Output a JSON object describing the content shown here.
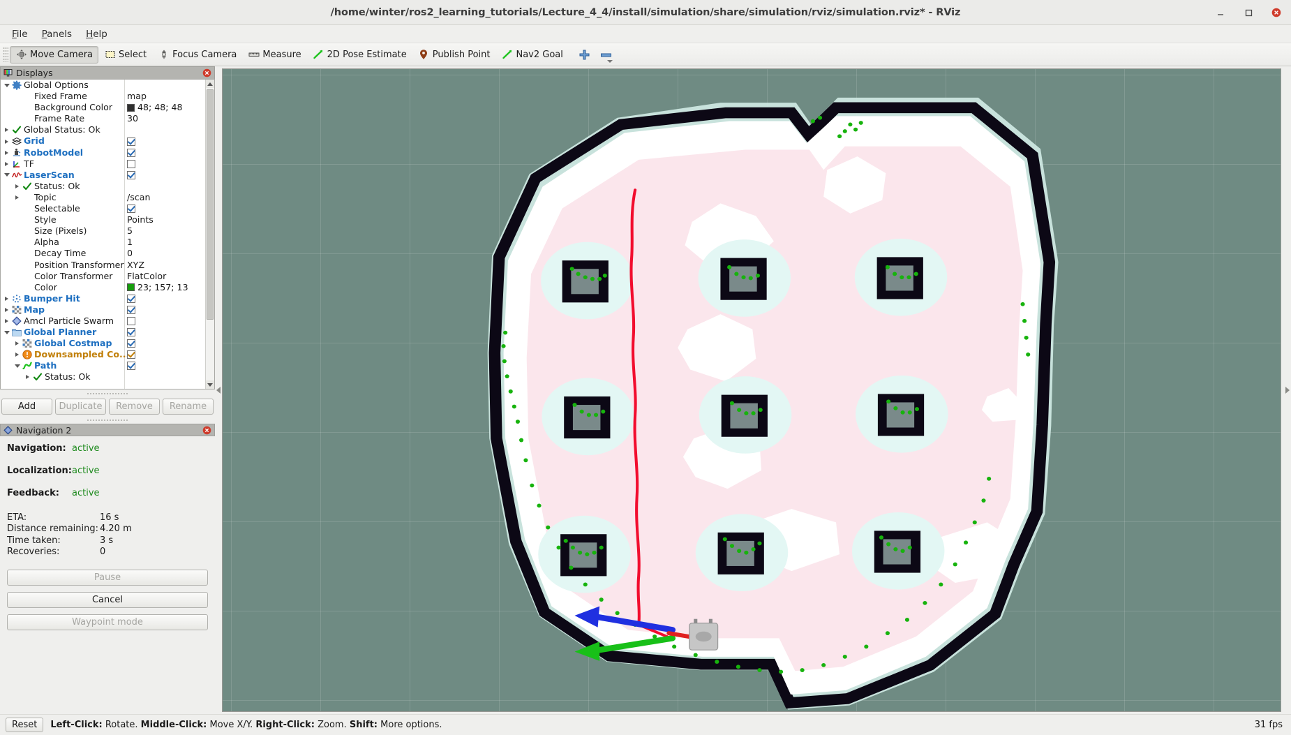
{
  "window": {
    "title": "/home/winter/ros2_learning_tutorials/Lecture_4_4/install/simulation/share/simulation/rviz/simulation.rviz* - RViz",
    "minimize_icon": "minimize-icon",
    "maximize_icon": "maximize-icon",
    "close_icon": "close-icon"
  },
  "menubar": {
    "items": [
      {
        "label": "File",
        "mnemonic": "F"
      },
      {
        "label": "Panels",
        "mnemonic": "P"
      },
      {
        "label": "Help",
        "mnemonic": "H"
      }
    ]
  },
  "toolbar": {
    "buttons": [
      {
        "label": "Move Camera",
        "icon": "move-camera-icon",
        "active": true
      },
      {
        "label": "Select",
        "icon": "select-icon",
        "active": false
      },
      {
        "label": "Focus Camera",
        "icon": "focus-camera-icon",
        "active": false
      },
      {
        "label": "Measure",
        "icon": "measure-icon",
        "active": false
      },
      {
        "label": "2D Pose Estimate",
        "icon": "pose-estimate-icon",
        "active": false
      },
      {
        "label": "Publish Point",
        "icon": "publish-point-icon",
        "active": false
      },
      {
        "label": "Nav2 Goal",
        "icon": "nav2-goal-icon",
        "active": false
      }
    ],
    "add_tool_icon": "plus-icon",
    "remove_tool_icon": "minus-icon",
    "overflow_icon": "chevron-down-icon"
  },
  "displays_panel": {
    "title": "Displays",
    "icon": "displays-icon",
    "close_icon": "close-icon",
    "rows": [
      {
        "indent": 0,
        "arrow": "open",
        "icon": "gear-icon",
        "label": "Global Options",
        "style": "normal",
        "value_type": "none"
      },
      {
        "indent": 1,
        "arrow": "none",
        "icon": "none",
        "label": "Fixed Frame",
        "style": "normal",
        "value_type": "text",
        "value": "map"
      },
      {
        "indent": 1,
        "arrow": "none",
        "icon": "none",
        "label": "Background Color",
        "style": "normal",
        "value_type": "color",
        "value": "48; 48; 48",
        "color": "#303030"
      },
      {
        "indent": 1,
        "arrow": "none",
        "icon": "none",
        "label": "Frame Rate",
        "style": "normal",
        "value_type": "text",
        "value": "30"
      },
      {
        "indent": 0,
        "arrow": "closed",
        "icon": "check-icon",
        "label": "Global Status: Ok",
        "style": "normal",
        "value_type": "none"
      },
      {
        "indent": 0,
        "arrow": "closed",
        "icon": "grid-icon",
        "label": "Grid",
        "style": "bluebold",
        "value_type": "check",
        "checked": true
      },
      {
        "indent": 0,
        "arrow": "closed",
        "icon": "robotmodel-icon",
        "label": "RobotModel",
        "style": "bluebold",
        "value_type": "check",
        "checked": true
      },
      {
        "indent": 0,
        "arrow": "closed",
        "icon": "tf-icon",
        "label": "TF",
        "style": "normal",
        "value_type": "check",
        "checked": false
      },
      {
        "indent": 0,
        "arrow": "open",
        "icon": "laserscan-icon",
        "label": "LaserScan",
        "style": "bluebold",
        "value_type": "check",
        "checked": true
      },
      {
        "indent": 1,
        "arrow": "closed",
        "icon": "check-icon",
        "label": "Status: Ok",
        "style": "normal",
        "value_type": "none"
      },
      {
        "indent": 1,
        "arrow": "closed",
        "icon": "none",
        "label": "Topic",
        "style": "normal",
        "value_type": "text",
        "value": "/scan"
      },
      {
        "indent": 1,
        "arrow": "none",
        "icon": "none",
        "label": "Selectable",
        "style": "normal",
        "value_type": "check",
        "checked": true
      },
      {
        "indent": 1,
        "arrow": "none",
        "icon": "none",
        "label": "Style",
        "style": "normal",
        "value_type": "text",
        "value": "Points"
      },
      {
        "indent": 1,
        "arrow": "none",
        "icon": "none",
        "label": "Size (Pixels)",
        "style": "normal",
        "value_type": "text",
        "value": "5"
      },
      {
        "indent": 1,
        "arrow": "none",
        "icon": "none",
        "label": "Alpha",
        "style": "normal",
        "value_type": "text",
        "value": "1"
      },
      {
        "indent": 1,
        "arrow": "none",
        "icon": "none",
        "label": "Decay Time",
        "style": "normal",
        "value_type": "text",
        "value": "0"
      },
      {
        "indent": 1,
        "arrow": "none",
        "icon": "none",
        "label": "Position Transformer",
        "style": "normal",
        "value_type": "text",
        "value": "XYZ"
      },
      {
        "indent": 1,
        "arrow": "none",
        "icon": "none",
        "label": "Color Transformer",
        "style": "normal",
        "value_type": "text",
        "value": "FlatColor"
      },
      {
        "indent": 1,
        "arrow": "none",
        "icon": "none",
        "label": "Color",
        "style": "normal",
        "value_type": "color",
        "value": "23; 157; 13",
        "color": "#179d0d"
      },
      {
        "indent": 0,
        "arrow": "closed",
        "icon": "bumperhit-icon",
        "label": "Bumper Hit",
        "style": "bluebold",
        "value_type": "check",
        "checked": true
      },
      {
        "indent": 0,
        "arrow": "closed",
        "icon": "map-icon",
        "label": "Map",
        "style": "bluebold",
        "value_type": "check",
        "checked": true
      },
      {
        "indent": 0,
        "arrow": "closed",
        "icon": "particle-icon",
        "label": "Amcl Particle Swarm",
        "style": "normal",
        "value_type": "check",
        "checked": false
      },
      {
        "indent": 0,
        "arrow": "open",
        "icon": "folder-icon",
        "label": "Global Planner",
        "style": "bluebold",
        "value_type": "check",
        "checked": true
      },
      {
        "indent": 1,
        "arrow": "closed",
        "icon": "map-icon",
        "label": "Global Costmap",
        "style": "bluebold",
        "value_type": "check",
        "checked": true
      },
      {
        "indent": 1,
        "arrow": "closed",
        "icon": "warning-icon",
        "label": "Downsampled Co...",
        "style": "orangebold",
        "value_type": "check",
        "checked": true,
        "check_color": "orange"
      },
      {
        "indent": 1,
        "arrow": "open",
        "icon": "path-icon",
        "label": "Path",
        "style": "bluebold",
        "value_type": "check",
        "checked": true
      },
      {
        "indent": 2,
        "arrow": "closed",
        "icon": "check-icon",
        "label": "Status: Ok",
        "style": "normal",
        "value_type": "none"
      }
    ],
    "buttons": [
      {
        "label": "Add",
        "disabled": false
      },
      {
        "label": "Duplicate",
        "disabled": true
      },
      {
        "label": "Remove",
        "disabled": true
      },
      {
        "label": "Rename",
        "disabled": true
      }
    ]
  },
  "navigation_panel": {
    "title": "Navigation 2",
    "icon": "nav2-icon",
    "close_icon": "close-icon",
    "statuses": [
      {
        "key": "Navigation:",
        "value": "active"
      },
      {
        "key": "Localization:",
        "value": "active"
      },
      {
        "key": "Feedback:",
        "value": "active"
      }
    ],
    "metrics": [
      {
        "key": "ETA:",
        "value": "16 s"
      },
      {
        "key": "Distance remaining:",
        "value": "4.20 m"
      },
      {
        "key": "Time taken:",
        "value": "3 s"
      },
      {
        "key": "Recoveries:",
        "value": "0"
      }
    ],
    "buttons": [
      {
        "label": "Pause",
        "disabled": true
      },
      {
        "label": "Cancel",
        "disabled": false
      },
      {
        "label": "Waypoint mode",
        "disabled": true
      }
    ],
    "status_color": "#1f8b1f"
  },
  "statusbar": {
    "reset_label": "Reset",
    "hint_parts": [
      {
        "text": "Left-Click:",
        "bold": true
      },
      {
        "text": " Rotate. ",
        "bold": false
      },
      {
        "text": "Middle-Click:",
        "bold": true
      },
      {
        "text": " Move X/Y. ",
        "bold": false
      },
      {
        "text": "Right-Click:",
        "bold": true
      },
      {
        "text": " Zoom. ",
        "bold": false
      },
      {
        "text": "Shift:",
        "bold": true
      },
      {
        "text": " More options.",
        "bold": false
      }
    ],
    "fps": "31 fps"
  },
  "view3d": {
    "background_color": "#6f8b83",
    "free_space_color": "#ffffff",
    "inflation_near_color": "#fbe6ec",
    "inflation_far_color": "#e3f7f4",
    "obstacle_color": "#0c0815",
    "path_color": "#f20d2e",
    "laser_color": "#17b30d",
    "axis_x_color": "#e02020",
    "axis_y_color": "#18c018",
    "axis_z_color": "#2030e0",
    "robot_color": "#c6c6c6"
  }
}
